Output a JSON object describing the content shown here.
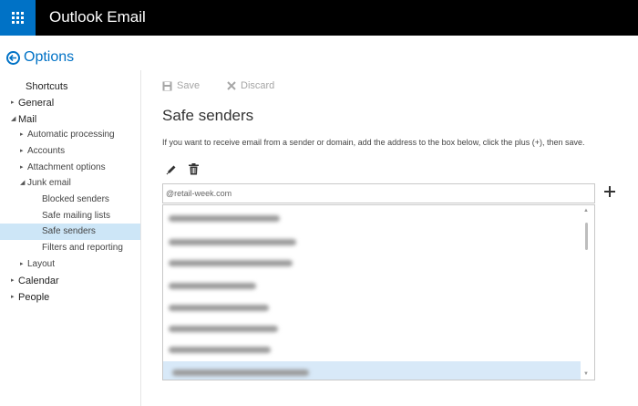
{
  "app": {
    "title": "Outlook Email"
  },
  "header": {
    "options_label": "Options"
  },
  "sidebar": {
    "items": [
      {
        "label": "Shortcuts",
        "caret": ""
      },
      {
        "label": "General",
        "caret": "▸"
      },
      {
        "label": "Mail",
        "caret": "◢"
      },
      {
        "label": "Automatic processing",
        "caret": "▸"
      },
      {
        "label": "Accounts",
        "caret": "▸"
      },
      {
        "label": "Attachment options",
        "caret": "▸"
      },
      {
        "label": "Junk email",
        "caret": "◢"
      },
      {
        "label": "Blocked senders",
        "caret": ""
      },
      {
        "label": "Safe mailing lists",
        "caret": ""
      },
      {
        "label": "Safe senders",
        "caret": ""
      },
      {
        "label": "Filters and reporting",
        "caret": ""
      },
      {
        "label": "Layout",
        "caret": "▸"
      },
      {
        "label": "Calendar",
        "caret": "▸"
      },
      {
        "label": "People",
        "caret": "▸"
      }
    ],
    "selected": "Safe senders"
  },
  "toolbar": {
    "save_label": "Save",
    "discard_label": "Discard"
  },
  "main": {
    "title": "Safe senders",
    "description": "If you want to receive email from a sender or domain, add the address to the box below, click the plus (+), then save.",
    "input_value": "@retail-week.com"
  },
  "list": {
    "blurred_entry_count": 9
  },
  "colors": {
    "accent": "#0072c6",
    "topbar": "#000000",
    "selection": "#cde6f7"
  }
}
